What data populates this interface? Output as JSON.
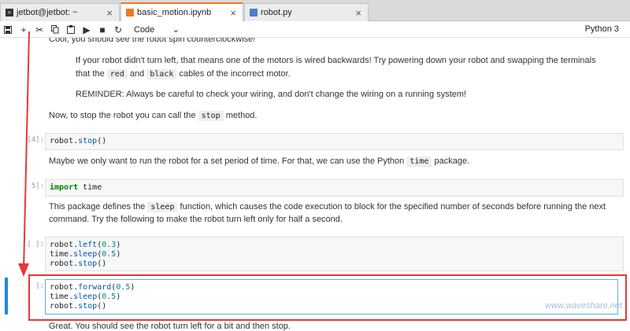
{
  "tabs": [
    {
      "label": "jetbot@jetbot: ~",
      "icon": "terminal-icon",
      "active": false
    },
    {
      "label": "basic_motion.ipynb",
      "icon": "notebook-icon",
      "active": true
    },
    {
      "label": "robot.py",
      "icon": "python-file-icon",
      "active": false
    }
  ],
  "toolbar": {
    "cell_type": "Code",
    "kernel": "Python 3"
  },
  "markdown": {
    "spin_text": "Cool, you should see the robot spin counterclockwise!",
    "wiring_pre": "If your robot didn't turn left, that means one of the motors is wired backwards! Try powering down your robot and swapping the terminals",
    "wiring_line2_a": "that the",
    "wiring_red": "red",
    "wiring_and": "and",
    "wiring_black": "black",
    "wiring_line2_b": "cables of the incorrect motor.",
    "reminder": "REMINDER: Always be careful to check your wiring, and don't change the wiring on a running system!",
    "stop_a": "Now, to stop the robot you can call the",
    "stop_code": "stop",
    "stop_b": "method.",
    "time_a": "Maybe we only want to run the robot for a set period of time. For that, we can use the Python",
    "time_code": "time",
    "time_b": "package.",
    "sleep_a": "This package defines the",
    "sleep_code": "sleep",
    "sleep_b": "function, which causes the code execution to block for the specified number of seconds before running the next",
    "sleep_line2": "command. Try the following to make the robot turn left only for half a second.",
    "great": "Great. You should see the robot turn left for a bit and then stop."
  },
  "cells": {
    "c1_prompt": "[4]:",
    "c2_prompt": "5]:",
    "c3_prompt": "[ ]:",
    "c4_prompt": "[ ]:"
  },
  "watermark": "www.waveshare.net"
}
